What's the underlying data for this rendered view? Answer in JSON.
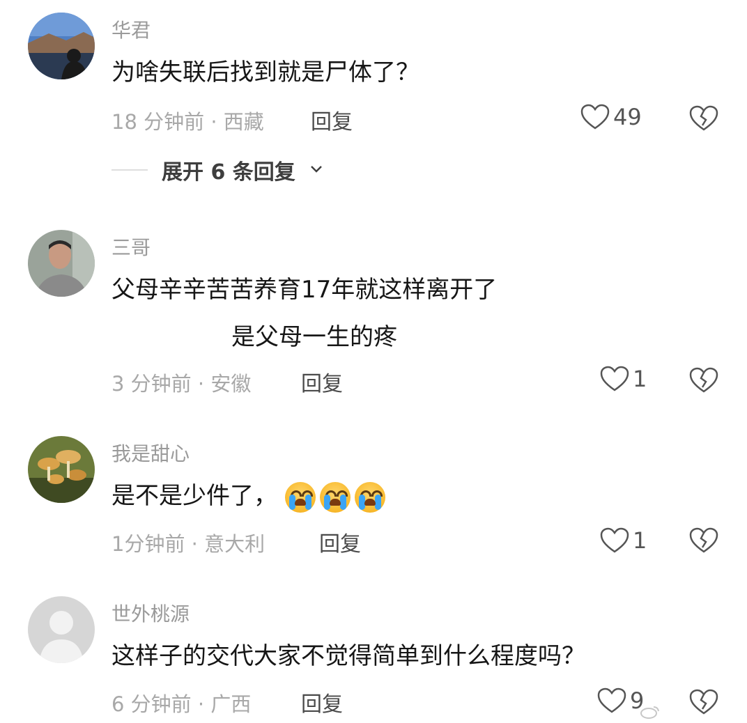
{
  "comments": [
    {
      "username": "华君",
      "text_lines": [
        "为啥失联后找到就是尸体了？"
      ],
      "time_location": "18 分钟前 · 西藏",
      "reply_label": "回复",
      "like_count": "49",
      "expand_label": "展开 6 条回复",
      "avatar_colors": {
        "sky": "#4f7fc4",
        "ground": "#2b3a52"
      }
    },
    {
      "username": "三哥",
      "text_lines": [
        "父母辛辛苦苦养育17年就这样离开了",
        "是父母一生的疼"
      ],
      "time_location": "3 分钟前 · 安徽",
      "reply_label": "回复",
      "like_count": "1",
      "avatar_colors": {
        "bg": "#9aa39a",
        "face": "#c89a82"
      }
    },
    {
      "username": "我是甜心",
      "text_lines": [
        "是不是少件了，"
      ],
      "emoji_icons": [
        "loudly-crying-face",
        "loudly-crying-face",
        "loudly-crying-face"
      ],
      "time_location": "1分钟前 · 意大利",
      "reply_label": "回复",
      "like_count": "1",
      "avatar_colors": {
        "bg": "#6b7a3a",
        "mushroom": "#d9a24a"
      }
    },
    {
      "username": "世外桃源",
      "text_lines": [
        "这样子的交代大家不觉得简单到什么程度吗？"
      ],
      "time_location": "6 分钟前 · 广西",
      "reply_label": "回复",
      "like_count": "9",
      "avatar_colors": {
        "bg": "#d6d6d6",
        "figure": "#f2f2f2"
      }
    }
  ],
  "icons": {
    "like": "heart-outline-icon",
    "dislike": "broken-heart-icon",
    "expand": "chevron-down-icon"
  },
  "colors": {
    "text": "#161616",
    "muted": "#a8a8a8",
    "username": "#9a9a9a"
  }
}
